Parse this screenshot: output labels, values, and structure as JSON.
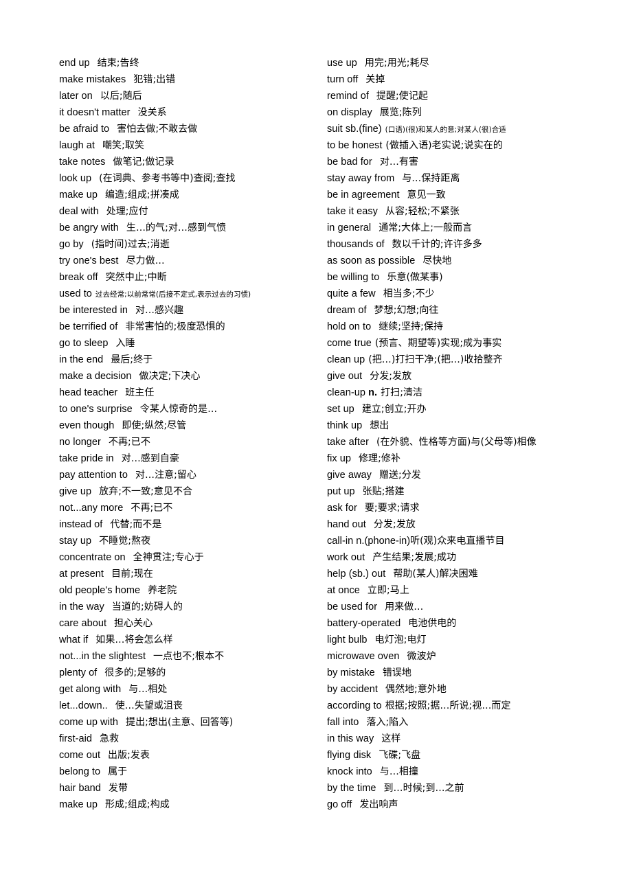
{
  "document": {
    "type": "vocabulary-list",
    "title": "English Phrases with Chinese Definitions",
    "background_color": "#ffffff",
    "text_color": "#000000",
    "column_count": 2
  },
  "columns": [
    {
      "name": "left-column",
      "entries": [
        {
          "term": "end up",
          "gap": "wide",
          "definition": "结束;告终",
          "def_size": "normal"
        },
        {
          "term": "make mistakes",
          "gap": "wide",
          "definition": "犯错;出错",
          "def_size": "normal"
        },
        {
          "term": "later on",
          "gap": "wide",
          "definition": "以后;随后",
          "def_size": "normal"
        },
        {
          "term": "it doesn't matter",
          "gap": "wide",
          "definition": "没关系",
          "def_size": "normal"
        },
        {
          "term": "be afraid to",
          "gap": "wide",
          "definition": "害怕去做;不敢去做",
          "def_size": "normal"
        },
        {
          "term": "laugh at",
          "gap": "wide",
          "definition": "嘲笑;取笑",
          "def_size": "normal"
        },
        {
          "term": "take notes",
          "gap": "wide",
          "definition": "做笔记;做记录",
          "def_size": "normal"
        },
        {
          "term": "look up",
          "gap": "wide",
          "definition": "(在词典、参考书等中)查阅;查找",
          "def_size": "normal"
        },
        {
          "term": "make up",
          "gap": "wide",
          "definition": "编造;组成;拼凑成",
          "def_size": "normal"
        },
        {
          "term": "deal with",
          "gap": "wide",
          "definition": "处理;应付",
          "def_size": "normal"
        },
        {
          "term": "be angry with",
          "gap": "wide",
          "definition": "生…的气;对…感到气愤",
          "def_size": "normal"
        },
        {
          "term": "go by",
          "gap": "wide",
          "definition": "(指时间)过去;消逝",
          "def_size": "normal"
        },
        {
          "term": "try one's best",
          "gap": "wide",
          "definition": "尽力做…",
          "def_size": "normal"
        },
        {
          "term": "break off",
          "gap": "wide",
          "definition": "突然中止;中断",
          "def_size": "normal"
        },
        {
          "term": "used to",
          "gap": "narrow",
          "definition": "过去经常;以前常常(后接不定式,表示过去的习惯)",
          "def_size": "small"
        },
        {
          "term": "be interested in",
          "gap": "wide",
          "definition": "对…感兴趣",
          "def_size": "normal"
        },
        {
          "term": "be terrified of",
          "gap": "wide",
          "definition": "非常害怕的;极度恐惧的",
          "def_size": "normal"
        },
        {
          "term": "go to sleep",
          "gap": "wide",
          "definition": "入睡",
          "def_size": "normal"
        },
        {
          "term": "in the end",
          "gap": "wide",
          "definition": "最后;终于",
          "def_size": "normal"
        },
        {
          "term": "make a decision",
          "gap": "wide",
          "definition": "做决定;下决心",
          "def_size": "normal"
        },
        {
          "term": "head teacher",
          "gap": "wide",
          "definition": "班主任",
          "def_size": "normal"
        },
        {
          "term": "to one's surprise",
          "gap": "wide",
          "definition": "令某人惊奇的是…",
          "def_size": "normal"
        },
        {
          "term": "even though",
          "gap": "wide",
          "definition": "即使;纵然;尽管",
          "def_size": "normal"
        },
        {
          "term": "no longer",
          "gap": "wide",
          "definition": "不再;已不",
          "def_size": "normal"
        },
        {
          "term": "take pride in",
          "gap": "wide",
          "definition": "对…感到自豪",
          "def_size": "normal"
        },
        {
          "term": "pay attention to",
          "gap": "wide",
          "definition": "对…注意;留心",
          "def_size": "normal"
        },
        {
          "term": "give up",
          "gap": "wide",
          "definition": "放弃;不一致;意见不合",
          "def_size": "normal"
        },
        {
          "term": "not...any more",
          "gap": "wide",
          "definition": "不再;已不",
          "def_size": "normal"
        },
        {
          "term": "instead of",
          "gap": "wide",
          "definition": "代替;而不是",
          "def_size": "normal"
        },
        {
          "term": "stay up",
          "gap": "wide",
          "definition": "不睡觉;熬夜",
          "def_size": "normal"
        },
        {
          "term": "concentrate on",
          "gap": "wide",
          "definition": "全神贯注;专心于",
          "def_size": "normal"
        },
        {
          "term": "at present",
          "gap": "wide",
          "definition": "目前;现在",
          "def_size": "normal"
        },
        {
          "term": "old people's home",
          "gap": "wide",
          "definition": "养老院",
          "def_size": "normal"
        },
        {
          "term": "in the way",
          "gap": "wide",
          "definition": "当道的;妨碍人的",
          "def_size": "normal"
        },
        {
          "term": "care about",
          "gap": "wide",
          "definition": "担心关心",
          "def_size": "normal"
        },
        {
          "term": "what if",
          "gap": "wide",
          "definition": "如果…将会怎么样",
          "def_size": "normal"
        },
        {
          "term": "not...in the slightest",
          "gap": "wide",
          "definition": "一点也不;根本不",
          "def_size": "normal"
        },
        {
          "term": "plenty of",
          "gap": "wide",
          "definition": "很多的;足够的",
          "def_size": "normal"
        },
        {
          "term": "get along with",
          "gap": "wide",
          "definition": "与…相处",
          "def_size": "normal"
        },
        {
          "term": "let...down..",
          "gap": "wide",
          "definition": "使…失望或沮丧",
          "def_size": "normal"
        },
        {
          "term": "come up with",
          "gap": "wide",
          "definition": "提出;想出(主意、回答等)",
          "def_size": "normal"
        },
        {
          "term": "first-aid",
          "gap": "wide",
          "definition": "急救",
          "def_size": "normal"
        },
        {
          "term": "come out",
          "gap": "wide",
          "definition": "出版;发表",
          "def_size": "normal"
        },
        {
          "term": "belong to",
          "gap": "wide",
          "definition": "属于",
          "def_size": "normal"
        },
        {
          "term": "hair band",
          "gap": "wide",
          "definition": "发带",
          "def_size": "normal"
        },
        {
          "term": "make up",
          "gap": "wide",
          "definition": "形成;组成;构成",
          "def_size": "normal"
        }
      ]
    },
    {
      "name": "right-column",
      "entries": [
        {
          "term": "use up",
          "gap": "wide",
          "definition": "用完;用光;耗尽",
          "def_size": "normal"
        },
        {
          "term": "turn off",
          "gap": "wide",
          "definition": "关掉",
          "def_size": "normal"
        },
        {
          "term": "remind of",
          "gap": "wide",
          "definition": "提醒;使记起",
          "def_size": "normal"
        },
        {
          "term": "on display",
          "gap": "wide",
          "definition": "展览;陈列",
          "def_size": "normal"
        },
        {
          "term": "suit sb.(fine)",
          "gap": "narrow",
          "definition": "(口语)(很)和某人的意;对某人(很)合适",
          "def_size": "small"
        },
        {
          "term": "to be honest",
          "gap": "narrow",
          "definition": "(做插入语)老实说;说实在的",
          "def_size": "normal"
        },
        {
          "term": "be bad for",
          "gap": "wide",
          "definition": "对…有害",
          "def_size": "normal"
        },
        {
          "term": "stay away from",
          "gap": "wide",
          "definition": "与…保持距离",
          "def_size": "normal"
        },
        {
          "term": "be in agreement",
          "gap": "wide",
          "definition": "意见一致",
          "def_size": "normal"
        },
        {
          "term": "take it easy",
          "gap": "wide",
          "definition": "从容;轻松;不紧张",
          "def_size": "normal"
        },
        {
          "term": "in general",
          "gap": "wide",
          "definition": "通常;大体上;一般而言",
          "def_size": "normal"
        },
        {
          "term": "thousands of",
          "gap": "wide",
          "definition": "数以千计的;许许多多",
          "def_size": "normal"
        },
        {
          "term": "as soon as possible",
          "gap": "wide",
          "definition": "尽快地",
          "def_size": "normal"
        },
        {
          "term": "be willing to",
          "gap": "wide",
          "definition": "乐意(做某事)",
          "def_size": "normal"
        },
        {
          "term": "quite a few",
          "gap": "wide",
          "definition": "相当多;不少",
          "def_size": "normal"
        },
        {
          "term": "dream of",
          "gap": "wide",
          "definition": "梦想;幻想;向往",
          "def_size": "normal"
        },
        {
          "term": "hold on to",
          "gap": "wide",
          "definition": "继续;坚持;保持",
          "def_size": "normal"
        },
        {
          "term": "come true",
          "gap": "narrow",
          "definition": "(预言、期望等)实现;成为事实",
          "def_size": "normal"
        },
        {
          "term": "clean up",
          "gap": "narrow",
          "definition": "(把…)打扫干净;(把…)收拾整齐",
          "def_size": "normal"
        },
        {
          "term": "give out",
          "gap": "wide",
          "definition": "分发;发放",
          "def_size": "normal"
        },
        {
          "term": "term_prefix:clean-up",
          "pos": "n.",
          "gap": "narrow",
          "definition": "打扫;清洁",
          "def_size": "normal"
        },
        {
          "term": "set up",
          "gap": "wide",
          "definition": "建立;创立;开办",
          "def_size": "normal"
        },
        {
          "term": "think up",
          "gap": "wide",
          "definition": "想出",
          "def_size": "normal"
        },
        {
          "term": "take after",
          "gap": "wide",
          "definition": "(在外貌、性格等方面)与(父母等)相像",
          "def_size": "normal"
        },
        {
          "term": "fix up",
          "gap": "wide",
          "definition": "修理;修补",
          "def_size": "normal"
        },
        {
          "term": "give away",
          "gap": "wide",
          "definition": "赠送;分发",
          "def_size": "normal"
        },
        {
          "term": "put up",
          "gap": "wide",
          "definition": "张贴;搭建",
          "def_size": "normal"
        },
        {
          "term": "ask for",
          "gap": "wide",
          "definition": "要;要求;请求",
          "def_size": "normal"
        },
        {
          "term": "hand out",
          "gap": "wide",
          "definition": "分发;发放",
          "def_size": "normal"
        },
        {
          "term": "call-in n.(phone-in)",
          "gap": "none",
          "definition": "听(观)众来电直播节目",
          "def_size": "normal"
        },
        {
          "term": "work out",
          "gap": "wide",
          "definition": "产生结果;发展;成功",
          "def_size": "normal"
        },
        {
          "term": "help (sb.) out",
          "gap": "wide",
          "definition": "帮助(某人)解决困难",
          "def_size": "normal"
        },
        {
          "term": "at once",
          "gap": "wide",
          "definition": "立即;马上",
          "def_size": "normal"
        },
        {
          "term": "be used for",
          "gap": "wide",
          "definition": "用来做…",
          "def_size": "normal"
        },
        {
          "term": "battery-operated",
          "gap": "wide",
          "definition": "电池供电的",
          "def_size": "normal"
        },
        {
          "term": "light bulb",
          "gap": "wide",
          "definition": "电灯泡;电灯",
          "def_size": "normal"
        },
        {
          "term": "microwave oven",
          "gap": "wide",
          "definition": "微波炉",
          "def_size": "normal"
        },
        {
          "term": "by mistake",
          "gap": "wide",
          "definition": "错误地",
          "def_size": "normal"
        },
        {
          "term": "by accident",
          "gap": "wide",
          "definition": "偶然地;意外地",
          "def_size": "normal"
        },
        {
          "term": "according to",
          "gap": "narrow",
          "definition": "根据;按照;据…所说;视…而定",
          "def_size": "normal"
        },
        {
          "term": "fall into",
          "gap": "wide",
          "definition": "落入;陷入",
          "def_size": "normal"
        },
        {
          "term": "in this way",
          "gap": "wide",
          "definition": "这样",
          "def_size": "normal"
        },
        {
          "term": "flying disk",
          "gap": "wide",
          "definition": "飞碟;飞盘",
          "def_size": "normal"
        },
        {
          "term": "knock into",
          "gap": "wide",
          "definition": "与…相撞",
          "def_size": "normal"
        },
        {
          "term": "by the time",
          "gap": "wide",
          "definition": "到…时候;到…之前",
          "def_size": "normal"
        },
        {
          "term": "go off",
          "gap": "wide",
          "definition": "发出响声",
          "def_size": "normal"
        }
      ]
    }
  ]
}
